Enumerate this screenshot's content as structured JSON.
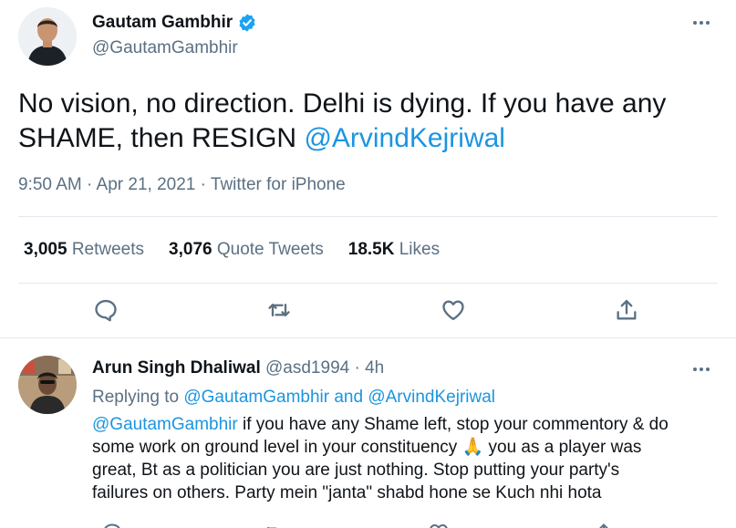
{
  "tweet": {
    "author_name": "Gautam Gambhir",
    "author_handle": "@GautamGambhir",
    "text_line1": "No vision, no direction. Delhi is dying. If you have any",
    "text_line2_prefix": "SHAME, then RESIGN ",
    "text_mention": "@ArvindKejriwal",
    "meta": "9:50 AM · Apr 21, 2021 · Twitter for iPhone",
    "stats": {
      "retweets_count": "3,005",
      "retweets_label": "Retweets",
      "quote_count": "3,076",
      "quote_label": "Quote Tweets",
      "likes_count": "18.5K",
      "likes_label": "Likes"
    },
    "icons": [
      "reply-icon",
      "retweet-icon",
      "like-icon",
      "share-icon"
    ]
  },
  "reply": {
    "author_name": "Arun Singh Dhaliwal",
    "author_handle": "@asd1994",
    "separator": " · ",
    "time": "4h",
    "replying_prefix": "Replying to ",
    "replying_user1": "@GautamGambhir",
    "replying_and": " and ",
    "replying_user2": "@ArvindKejriwal",
    "body_mention": "@GautamGambhir",
    "body_line1_rest": " if you have any Shame left, stop your commentory & do",
    "body_line2": "some work on ground level in your constituency ",
    "body_emoji": "🙏",
    "body_line2_rest": " you as a player was",
    "body_line3": "great, Bt as a politician you are just nothing. Stop putting your party's",
    "body_line4": "failures on others. Party mein \"janta\" shabd hone se Kuch nhi hota"
  },
  "colors": {
    "link": "#1b95e0",
    "muted": "#5b7083",
    "text": "#0f1419",
    "divider": "#e1e8ed",
    "verified": "#1da1f2"
  }
}
